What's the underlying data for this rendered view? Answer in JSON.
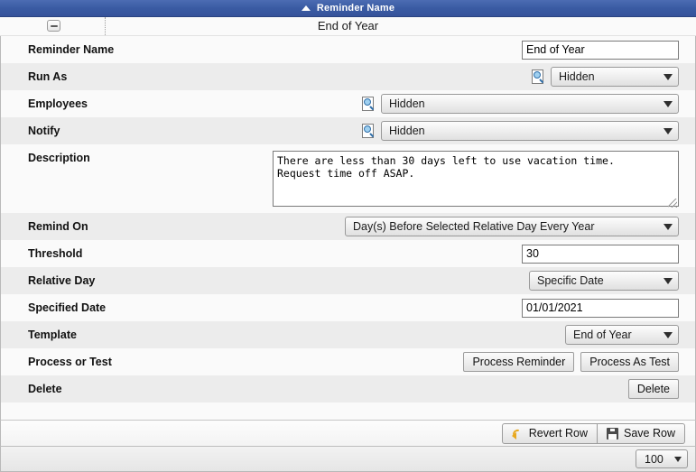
{
  "header": {
    "sort_indicator": "ascending-sort-arrow",
    "column_title": "Reminder Name"
  },
  "record": {
    "collapse_icon": "minus-collapse-icon",
    "title": "End of Year"
  },
  "rows": [
    {
      "label": "Reminder Name",
      "value": "End of Year"
    },
    {
      "label": "Run As",
      "value": "Hidden",
      "lookup_icon": "document-search-icon"
    },
    {
      "label": "Employees",
      "value": "Hidden",
      "lookup_icon": "document-search-icon"
    },
    {
      "label": "Notify",
      "value": "Hidden",
      "lookup_icon": "document-search-icon"
    },
    {
      "label": "Description",
      "value": "There are less than 30 days left to use vacation time.\nRequest time off ASAP."
    },
    {
      "label": "Remind On",
      "value": "Day(s) Before Selected Relative Day Every Year"
    },
    {
      "label": "Threshold",
      "value": "30"
    },
    {
      "label": "Relative Day",
      "value": "Specific Date"
    },
    {
      "label": "Specified Date",
      "value": "01/01/2021"
    },
    {
      "label": "Template",
      "value": "End of Year"
    },
    {
      "label": "Process or Test"
    },
    {
      "label": "Delete"
    }
  ],
  "buttons": {
    "process_reminder": "Process Reminder",
    "process_as_test": "Process As Test",
    "delete": "Delete",
    "revert_row": "Revert Row",
    "save_row": "Save Row",
    "revert_icon": "undo-arrow-icon",
    "save_icon": "floppy-disk-icon"
  },
  "pager": {
    "page_size": "100"
  },
  "colors": {
    "header_blue": "#3a5ba3",
    "row_alt": "#ececec",
    "row_base": "#fafafa",
    "revert_icon": "#e8a81e"
  }
}
